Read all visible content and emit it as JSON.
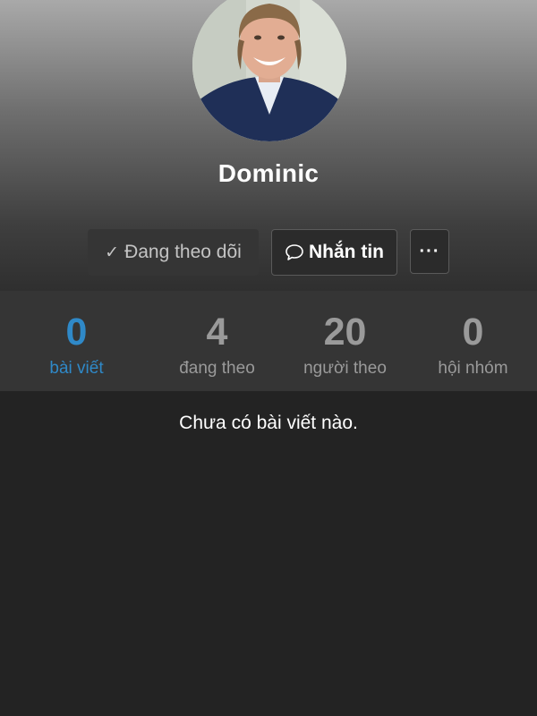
{
  "profile": {
    "name": "Dominic"
  },
  "actions": {
    "following_label": "Đang theo dõi",
    "message_label": "Nhắn tin",
    "more_label": "···",
    "following_icon": "check-icon",
    "message_icon": "chat-bubble-icon"
  },
  "stats": [
    {
      "count": "0",
      "label": "bài viết",
      "active": true
    },
    {
      "count": "4",
      "label": "đang theo",
      "active": false
    },
    {
      "count": "20",
      "label": "người theo",
      "active": false
    },
    {
      "count": "0",
      "label": "hội nhóm",
      "active": false
    }
  ],
  "feed": {
    "empty_message": "Chưa có bài viết nào."
  },
  "colors": {
    "accent": "#2f89c8",
    "background": "#232323",
    "stats_bar": "#353535",
    "muted_text": "#9a9a9a"
  }
}
